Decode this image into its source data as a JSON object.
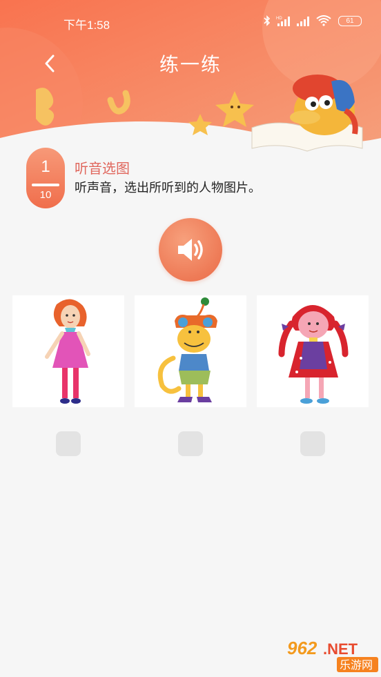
{
  "status_bar": {
    "time": "下午1:58",
    "battery_level": "61",
    "icons": [
      "bluetooth-icon",
      "hd-signal-icon",
      "signal-icon",
      "wifi-icon",
      "battery-icon"
    ]
  },
  "header": {
    "title": "练一练",
    "back_icon": "chevron-left-icon",
    "colors": {
      "gradient_start": "#f8865f",
      "gradient_end": "#f5a27a",
      "white": "#ffffff"
    }
  },
  "question": {
    "current": "1",
    "total": "10",
    "type_label": "听音选图",
    "instruction": "听声音，选出所听到的人物图片。"
  },
  "audio": {
    "icon": "speaker-icon",
    "accent": "#ee7a56"
  },
  "options": [
    {
      "id": "option-1",
      "image": "girl-pink-dress",
      "checked": false
    },
    {
      "id": "option-2",
      "image": "yellow-monster",
      "checked": false
    },
    {
      "id": "option-3",
      "image": "girl-red-braids",
      "checked": false
    }
  ],
  "watermark": {
    "brand": "962",
    "suffix": ".NET",
    "name": "乐游网"
  }
}
